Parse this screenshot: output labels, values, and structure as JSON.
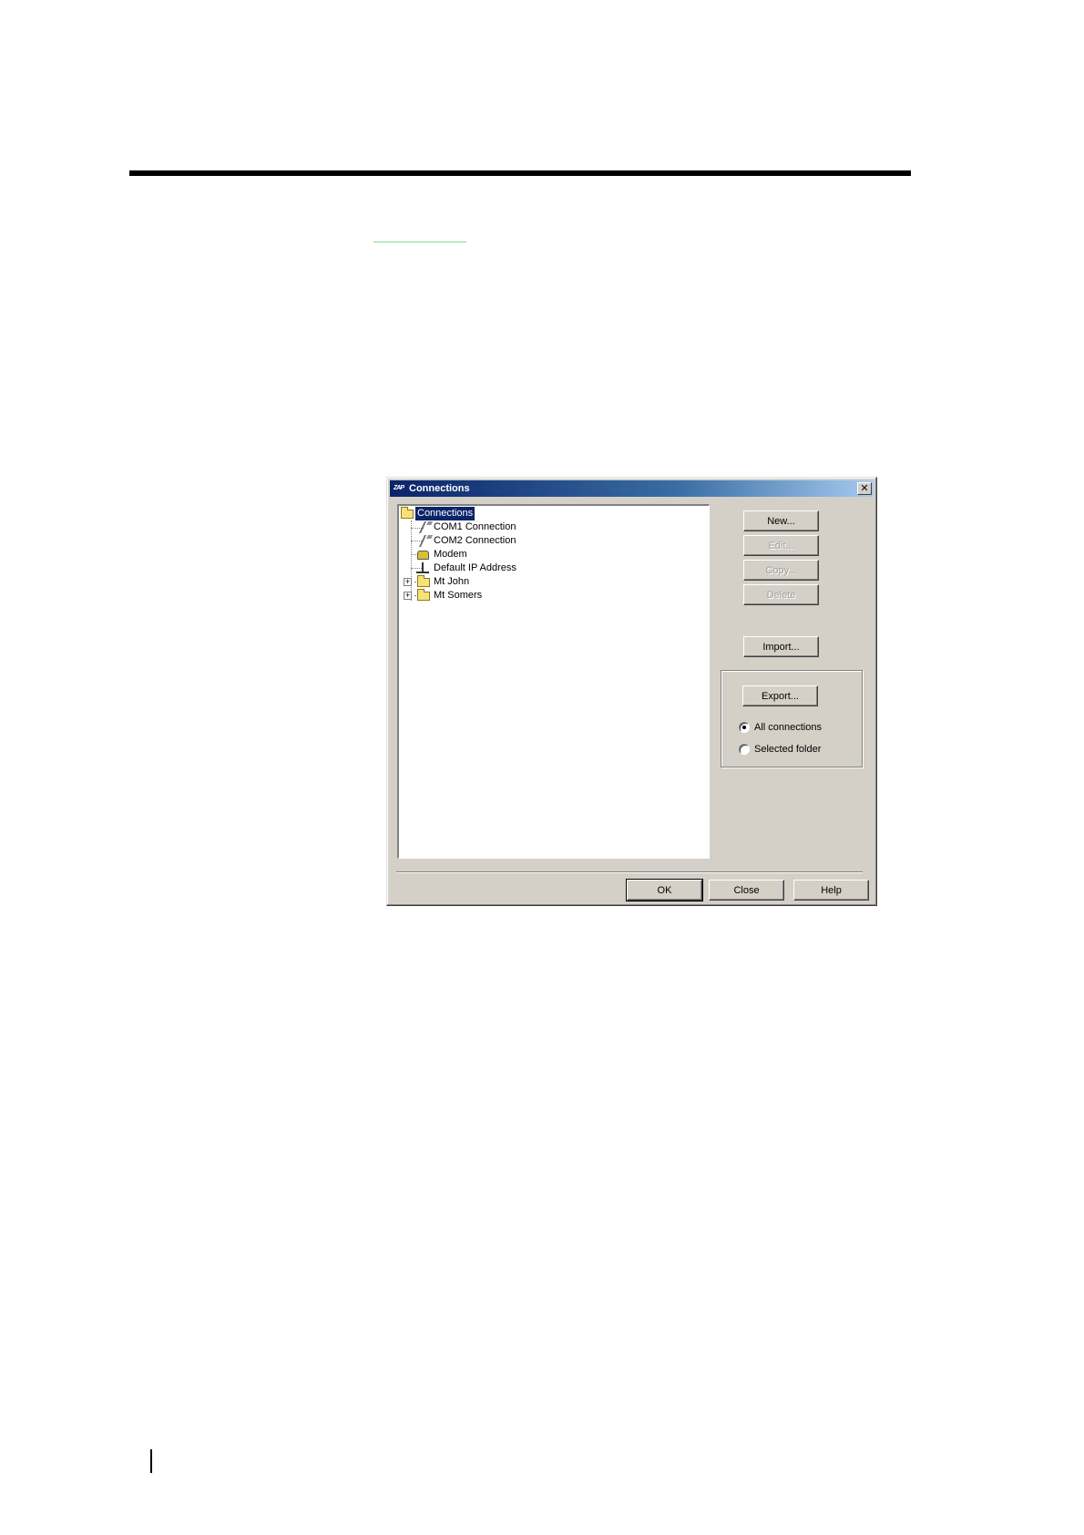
{
  "dialog": {
    "logo_text": "ZAP",
    "title": "Connections",
    "close_glyph": "✕"
  },
  "tree": {
    "root": "Connections",
    "items": [
      {
        "label": "COM1 Connection",
        "icon": "serial-plug-icon"
      },
      {
        "label": "COM2 Connection",
        "icon": "serial-plug-icon"
      },
      {
        "label": "Modem",
        "icon": "modem-icon"
      },
      {
        "label": "Default IP Address",
        "icon": "network-icon"
      },
      {
        "label": "Mt John",
        "icon": "folder-icon",
        "expandable": true
      },
      {
        "label": "Mt Somers",
        "icon": "folder-icon",
        "expandable": true
      }
    ],
    "expander_glyph": "+"
  },
  "buttons": {
    "new": "New...",
    "edit": "Edit...",
    "copy": "Copy...",
    "delete": "Delete",
    "import": "Import...",
    "export": "Export...",
    "ok": "OK",
    "close": "Close",
    "help": "Help"
  },
  "export_options": {
    "all": "All connections",
    "selected": "Selected folder",
    "checked": "all"
  }
}
